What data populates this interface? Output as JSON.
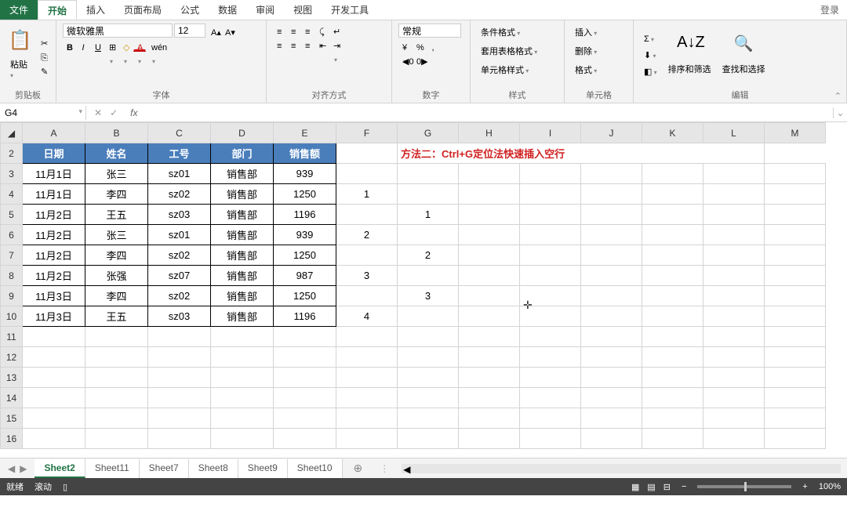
{
  "tabs": {
    "file": "文件",
    "home": "开始",
    "insert": "插入",
    "layout": "页面布局",
    "formula": "公式",
    "data": "数据",
    "review": "审阅",
    "view": "视图",
    "dev": "开发工具",
    "login": "登录"
  },
  "ribbon": {
    "clipboard": {
      "paste": "粘贴",
      "label": "剪贴板"
    },
    "font": {
      "name": "微软雅黑",
      "size": "12",
      "label": "字体"
    },
    "align": {
      "label": "对齐方式"
    },
    "number": {
      "fmt": "常规",
      "label": "数字",
      "pct": "%",
      "comma": ","
    },
    "styles": {
      "cond": "条件格式",
      "tbl": "套用表格格式",
      "cell": "单元格样式",
      "label": "样式"
    },
    "cells": {
      "ins": "插入",
      "del": "删除",
      "fmt": "格式",
      "label": "单元格"
    },
    "editing": {
      "sort": "排序和筛选",
      "find": "查找和选择",
      "label": "编辑"
    }
  },
  "namebox": "G4",
  "columns": [
    "A",
    "B",
    "C",
    "D",
    "E",
    "F",
    "G",
    "H",
    "I",
    "J",
    "K",
    "L",
    "M"
  ],
  "row_nums": [
    2,
    3,
    4,
    5,
    6,
    7,
    8,
    9,
    10,
    11,
    12,
    13,
    14,
    15,
    16
  ],
  "headers": [
    "日期",
    "姓名",
    "工号",
    "部门",
    "销售额"
  ],
  "rows": [
    [
      "11月1日",
      "张三",
      "sz01",
      "销售部",
      "939"
    ],
    [
      "11月1日",
      "李四",
      "sz02",
      "销售部",
      "1250"
    ],
    [
      "11月2日",
      "王五",
      "sz03",
      "销售部",
      "1196"
    ],
    [
      "11月2日",
      "张三",
      "sz01",
      "销售部",
      "939"
    ],
    [
      "11月2日",
      "李四",
      "sz02",
      "销售部",
      "1250"
    ],
    [
      "11月2日",
      "张强",
      "sz07",
      "销售部",
      "987"
    ],
    [
      "11月3日",
      "李四",
      "sz02",
      "销售部",
      "1250"
    ],
    [
      "11月3日",
      "王五",
      "sz03",
      "销售部",
      "1196"
    ]
  ],
  "fvals": {
    "4": "1",
    "6": "2",
    "8": "3",
    "10": "4"
  },
  "gvals": {
    "5": "1",
    "7": "2",
    "9": "3"
  },
  "annotation": "方法二：Ctrl+G定位法快速插入空行",
  "sheets": [
    "Sheet2",
    "Sheet11",
    "Sheet7",
    "Sheet8",
    "Sheet9",
    "Sheet10"
  ],
  "status": {
    "ready": "就绪",
    "scroll": "滚动",
    "zoom": "100%",
    "minus": "−",
    "plus": "+"
  },
  "icons": {
    "cut": "✂",
    "copy": "⎘",
    "brush": "✎",
    "bold": "B",
    "italic": "I",
    "underline": "U",
    "border": "⊞",
    "fill": "◇",
    "color": "A",
    "sigma": "Σ",
    "fill2": "⬇",
    "clear": "◧",
    "sortaz": "A↓Z",
    "find": "🔍",
    "fx": "fx",
    "check": "✓",
    "x": "✕",
    "merge": "⇥",
    "wrap": "↵",
    "curr": "¥",
    "inc": "◀0",
    "dec": "0▶",
    "paste": "📋",
    "new": "⊕",
    "grid": "▦",
    "page": "▤",
    "pgbrk": "⊟",
    "rec": "▯"
  }
}
